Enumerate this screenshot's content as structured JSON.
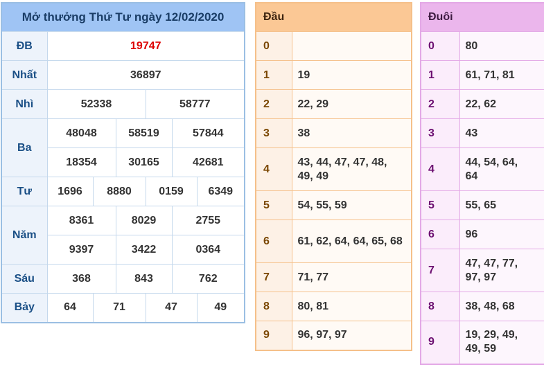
{
  "results": {
    "title": "Mở thưởng Thứ Tư ngày 12/02/2020",
    "rows": {
      "db": {
        "label": "ĐB",
        "values": [
          "19747"
        ]
      },
      "nhat": {
        "label": "Nhất",
        "values": [
          "36897"
        ]
      },
      "nhi": {
        "label": "Nhì",
        "values": [
          "52338",
          "58777"
        ]
      },
      "ba": {
        "label": "Ba",
        "values": [
          "48048",
          "58519",
          "57844",
          "18354",
          "30165",
          "42681"
        ]
      },
      "tu": {
        "label": "Tư",
        "values": [
          "1696",
          "8880",
          "0159",
          "6349"
        ]
      },
      "nam": {
        "label": "Năm",
        "values": [
          "8361",
          "8029",
          "2755",
          "9397",
          "3422",
          "0364"
        ]
      },
      "sau": {
        "label": "Sáu",
        "values": [
          "368",
          "843",
          "762"
        ]
      },
      "bay": {
        "label": "Bảy",
        "values": [
          "64",
          "71",
          "47",
          "49"
        ]
      }
    },
    "special_color": "#dd0000"
  },
  "dau": {
    "header": "Đầu",
    "rows": [
      {
        "key": "0",
        "values": ""
      },
      {
        "key": "1",
        "values": "19"
      },
      {
        "key": "2",
        "values": "22, 29"
      },
      {
        "key": "3",
        "values": "38"
      },
      {
        "key": "4",
        "values": "43, 44, 47, 47, 48, 49, 49"
      },
      {
        "key": "5",
        "values": "54, 55, 59"
      },
      {
        "key": "6",
        "values": "61, 62, 64, 64, 65, 68"
      },
      {
        "key": "7",
        "values": "71, 77"
      },
      {
        "key": "8",
        "values": "80, 81"
      },
      {
        "key": "9",
        "values": "96, 97, 97"
      }
    ]
  },
  "duoi": {
    "header": "Đuôi",
    "rows": [
      {
        "key": "0",
        "values": "80"
      },
      {
        "key": "1",
        "values": "61, 71, 81"
      },
      {
        "key": "2",
        "values": "22, 62"
      },
      {
        "key": "3",
        "values": "43"
      },
      {
        "key": "4",
        "values": "44, 54, 64, 64"
      },
      {
        "key": "5",
        "values": "55, 65"
      },
      {
        "key": "6",
        "values": "96"
      },
      {
        "key": "7",
        "values": "47, 47, 77, 97, 97"
      },
      {
        "key": "8",
        "values": "38, 48, 68"
      },
      {
        "key": "9",
        "values": "19, 29, 49, 49, 59"
      }
    ]
  }
}
